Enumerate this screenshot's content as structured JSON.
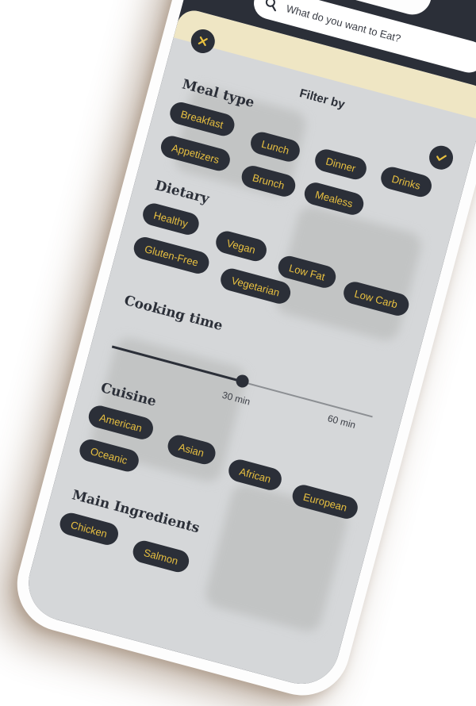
{
  "search": {
    "placeholder": "What do you want to Eat?"
  },
  "filter": {
    "title": "Filter by",
    "meal_type": {
      "title": "Meal type",
      "options": [
        "Breakfast",
        "Lunch",
        "Dinner",
        "Drinks",
        "Appetizers",
        "Brunch",
        "Mealess"
      ]
    },
    "dietary": {
      "title": "Dietary",
      "options": [
        "Healthy",
        "Vegan",
        "Low Fat",
        "Low Carb",
        "Gluten-Free",
        "Vegetarian"
      ]
    },
    "cooking_time": {
      "title": "Cooking time",
      "value_label": "30 min",
      "max_label": "60 min",
      "fraction": 0.5
    },
    "cuisine": {
      "title": "Cuisine",
      "options": [
        "American",
        "Asian",
        "African",
        "European",
        "Oceanic"
      ]
    },
    "main_ingredients": {
      "title": "Main Ingredients",
      "options": [
        "Chicken",
        "Salmon"
      ]
    }
  },
  "colors": {
    "dark": "#2b2f38",
    "accent": "#e8c040",
    "sheet": "#d5d7d9"
  }
}
